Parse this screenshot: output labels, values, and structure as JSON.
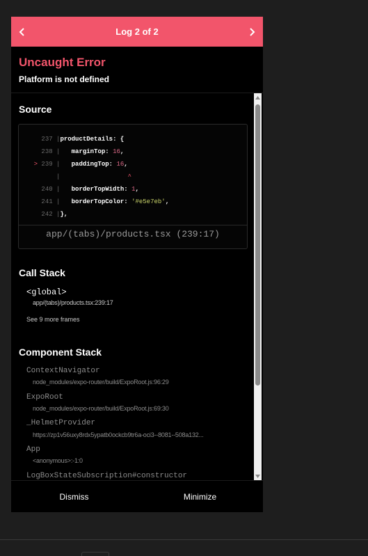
{
  "header": {
    "title": "Log 2 of 2",
    "prev_icon": "chevron-left-icon",
    "next_icon": "chevron-right-icon"
  },
  "error": {
    "title": "Uncaught Error",
    "message": "Platform is not defined"
  },
  "source": {
    "heading": "Source",
    "lines": [
      {
        "marker": "  ",
        "num": "237",
        "sep": " |",
        "key": "productDetails",
        "rest": ": {",
        "val": "",
        "valType": "",
        "end": ""
      },
      {
        "marker": "  ",
        "num": "238",
        "sep": " |   ",
        "key": "marginTop",
        "rest": ": ",
        "val": "16",
        "valType": "num",
        "end": ","
      },
      {
        "marker": "> ",
        "num": "239",
        "sep": " |   ",
        "key": "paddingTop",
        "rest": ": ",
        "val": "16",
        "valType": "num",
        "end": ","
      },
      {
        "marker": "  ",
        "num": "   ",
        "sep": " |",
        "key": "",
        "rest": "",
        "val": "",
        "valType": "",
        "end": "",
        "caret": "                  ^"
      },
      {
        "marker": "  ",
        "num": "240",
        "sep": " |   ",
        "key": "borderTopWidth",
        "rest": ": ",
        "val": "1",
        "valType": "num",
        "end": ","
      },
      {
        "marker": "  ",
        "num": "241",
        "sep": " |   ",
        "key": "borderTopColor",
        "rest": ": ",
        "val": "'#e5e7eb'",
        "valType": "str",
        "end": ","
      },
      {
        "marker": "  ",
        "num": "242",
        "sep": " |",
        "key": "",
        "rest": "},",
        "val": "",
        "valType": "",
        "end": ""
      }
    ],
    "file": "app/(tabs)/products.tsx (239:17)"
  },
  "call_stack": {
    "heading": "Call Stack",
    "frames": [
      {
        "fn": "<global>",
        "loc": "app/(tabs)/products.tsx:239:17"
      }
    ],
    "see_more": "See 9 more frames"
  },
  "component_stack": {
    "heading": "Component Stack",
    "items": [
      {
        "name": "ContextNavigator",
        "loc": "node_modules/expo-router/build/ExpoRoot.js:96:29"
      },
      {
        "name": "ExpoRoot",
        "loc": "node_modules/expo-router/build/ExpoRoot.js:69:30"
      },
      {
        "name": "_HelmetProvider",
        "loc": "https://zp1v56uxy8rdx5ypatb0ockcb9tr6a-oci3--8081--508a132..."
      },
      {
        "name": "App",
        "loc": "<anonymous>:-1:0"
      },
      {
        "name": "LogBoxStateSubscription#constructor",
        "loc": ""
      }
    ]
  },
  "footer": {
    "dismiss": "Dismiss",
    "minimize": "Minimize"
  },
  "colors": {
    "accent": "#f2556b",
    "background": "#000000",
    "page": "#1e1e1e"
  }
}
